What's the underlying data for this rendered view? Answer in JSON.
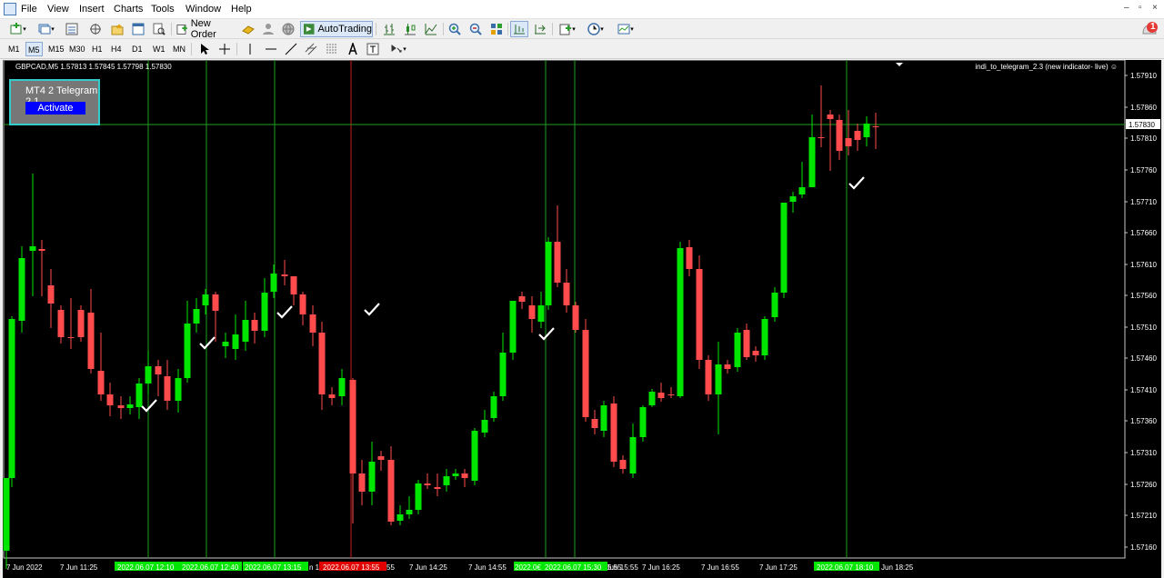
{
  "menubar": {
    "items": [
      "File",
      "View",
      "Insert",
      "Charts",
      "Tools",
      "Window",
      "Help"
    ]
  },
  "toolbar": {
    "new_order": "New Order",
    "auto_trading": "AutoTrading",
    "alert_count": "1"
  },
  "timeframes": [
    "M1",
    "M5",
    "M15",
    "M30",
    "H1",
    "H4",
    "D1",
    "W1",
    "MN"
  ],
  "selected_timeframe": "M5",
  "chart": {
    "symbol_info": "GBPCAD,M5  1.57813 1.57845 1.57798 1.57830",
    "indicator_label": "indi_to_telegram_2.3 (new indicator- live) ☺",
    "current_price_label": "1.57830",
    "price_labels": [
      "1.57910",
      "1.57860",
      "1.57810",
      "1.57760",
      "1.57710",
      "1.57660",
      "1.57610",
      "1.57560",
      "1.57510",
      "1.57460",
      "1.57410",
      "1.57360",
      "1.57310",
      "1.57260",
      "1.57210",
      "1.57160"
    ],
    "time_labels": [
      "7 Jun 2022",
      "7 Jun 11:25",
      "7 Jun 14:25",
      "7 Jun 14:55",
      "7 Jun 15:55",
      "7 Jun 16:25",
      "7 Jun 16:55",
      "7 Jun 17:25",
      "Jun 18:25"
    ],
    "signal_time_labels": [
      "2022.06.07 12:10",
      "2022.06.07 12:40",
      "2022.06.07 13:15",
      "2022.06.07 13:55",
      "2022.06.07 15:30",
      "2022.06.07 18:10"
    ],
    "overlapped_time_fragments": [
      "n 1",
      "55",
      "2022.0€",
      "5:55"
    ]
  },
  "telegram_panel": {
    "title": "MT4 2 Telegram 2.1",
    "button": "Activate"
  },
  "colors": {
    "bull": "#00e600",
    "bear": "#ff4b4b",
    "chart_bg": "#000000",
    "grid_green": "#1e9e1e",
    "red_line": "#c81e1e",
    "panel_border": "#33cccc",
    "activate_bg": "#0000ff"
  }
}
